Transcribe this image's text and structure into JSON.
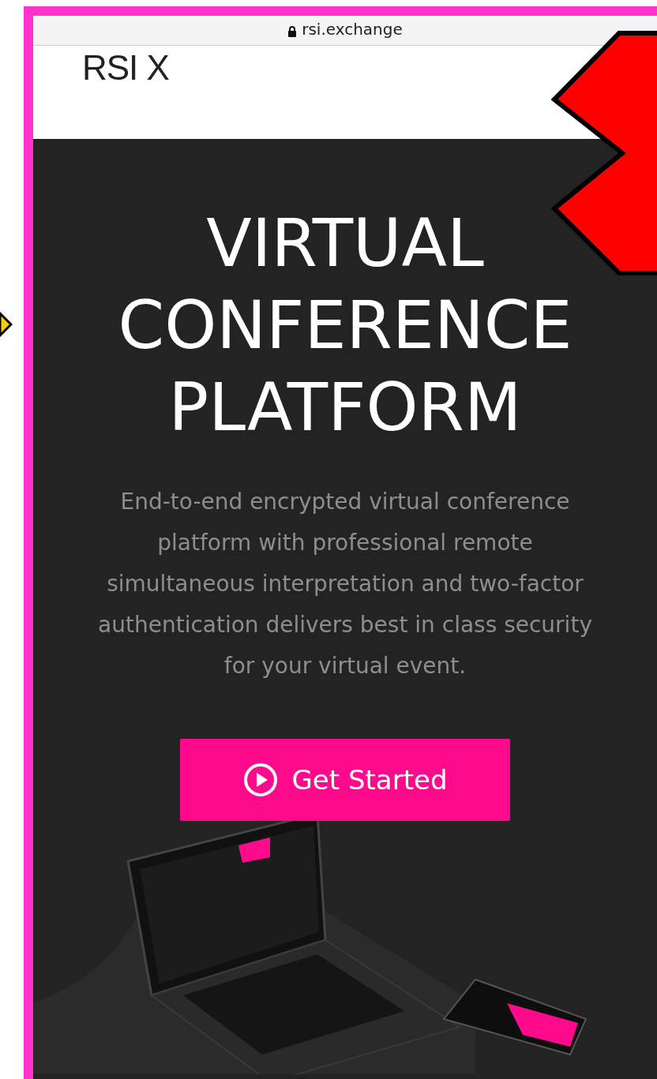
{
  "browser": {
    "url": "rsi.exchange"
  },
  "header": {
    "logo": "RSI X"
  },
  "hero": {
    "headline": "VIRTUAL CONFERENCE PLATFORM",
    "description": "End-to-end encrypted virtual conference platform with professional remote simultaneous interpretation and two-factor authentication delivers best in class security for your virtual event.",
    "button": {
      "label": "Get Started"
    }
  }
}
